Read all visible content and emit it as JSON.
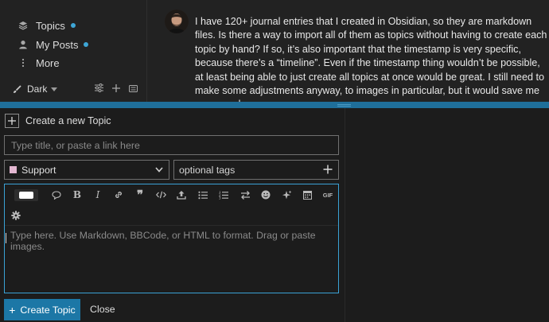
{
  "sidebar": {
    "items": [
      {
        "label": "Topics",
        "icon": "layers-icon",
        "dot": true
      },
      {
        "label": "My Posts",
        "icon": "user-icon",
        "dot": true
      },
      {
        "label": "More",
        "icon": "vertical-ellipsis-icon",
        "dot": false
      }
    ],
    "theme_label": "Dark",
    "footer_icons": [
      "sliders-icon",
      "plus-icon",
      "keyboard-icon"
    ],
    "dot_color": "#3ea6d6"
  },
  "post": {
    "text": "I have 120+ journal entries that I created in Obsidian, so they are markdown files. Is there a way to import all of them as topics without having to create each topic by hand? If so, it’s also important that the timestamp is very specific, because there’s a “timeline”. Even if the timestamp thing wouldn’t be possible, at least being able to just create all topics at once would be great. I still need to make some adjustments anyway, to images in particular, but it would save me some work."
  },
  "composer": {
    "heading": "Create a new Topic",
    "title_placeholder": "Type title, or paste a link here",
    "category": {
      "label": "Support",
      "color": "#e3b7d1"
    },
    "tags_placeholder": "optional tags",
    "editor_placeholder": "Type here. Use Markdown, BBCode, or HTML to format. Drag or paste images.",
    "toolbar": [
      "editor-mode-toggle",
      "quote-icon",
      "bold-icon",
      "italic-icon",
      "link-icon",
      "blockquote-icon",
      "code-icon",
      "upload-icon",
      "bullet-list-icon",
      "numbered-list-icon",
      "swap-icon",
      "emoji-icon",
      "sparkle-icon",
      "calendar-icon",
      "gif-icon",
      "gear-icon"
    ],
    "gif_label": "GIF",
    "submit_label": "Create Topic",
    "cancel_label": "Close"
  },
  "colors": {
    "accent": "#1c77a6",
    "divider": "#1f6f9a",
    "editor_border": "#3aa2d6"
  }
}
